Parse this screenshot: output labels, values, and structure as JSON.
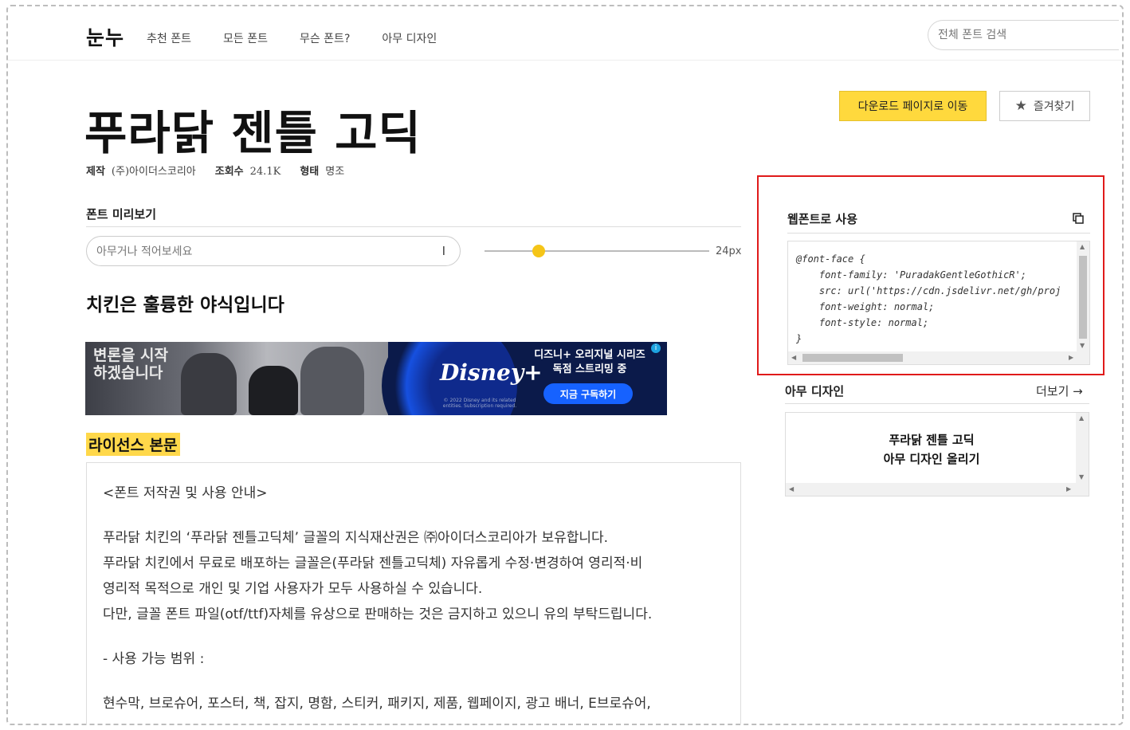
{
  "nav": {
    "logo": "눈누",
    "links": [
      "추천 폰트",
      "모든 폰트",
      "무슨 폰트?",
      "아무 디자인"
    ],
    "search_placeholder": "전체 폰트 검색"
  },
  "font": {
    "title": "푸라닭 젠틀 고딕",
    "maker_label": "제작",
    "maker": "(주)아이더스코리아",
    "views_label": "조회수",
    "views": "24.1K",
    "style_label": "형태",
    "style": "명조"
  },
  "actions": {
    "download": "다운로드 페이지로 이동",
    "favorite": "즐겨찾기"
  },
  "preview": {
    "heading": "폰트 미리보기",
    "input_placeholder": "아무거나 적어보세요",
    "size": "24px",
    "size_fraction": 0.24,
    "sample": "치킨은 훌륭한 야식입니다"
  },
  "ad": {
    "left_text": "변론을 시작하겠습니다",
    "brand": "Disney+",
    "fine_print": "© 2022 Disney and its related entities. Subscription required.",
    "headline": "디즈니+ 오리지널 시리즈 독점 스트리밍 중",
    "cta": "지금 구독하기",
    "info": "i"
  },
  "license": {
    "heading": "라이선스 본문",
    "title": "<폰트 저작권 및 사용 안내>",
    "p1": "푸라닭 치킨의 ‘푸라닭 젠틀고딕체’ 글꼴의 지식재산권은 ㈜아이더스코리아가 보유합니다.",
    "p2": "푸라닭 치킨에서 무료로 배포하는 글꼴은(푸라닭 젠틀고딕체) 자유롭게 수정·변경하여 영리적·비",
    "p3": "영리적 목적으로 개인 및 기업 사용자가 모두 사용하실 수 있습니다.",
    "p4": "다만, 글꼴 폰트 파일(otf/ttf)자체를 유상으로 판매하는 것은 금지하고 있으니 유의 부탁드립니다.",
    "range_title": "- 사용 가능 범위 :",
    "range_list": "현수막, 브로슈어, 포스터, 책, 잡지, 명함, 스티커, 패키지, 제품, 웹페이지, 광고 배너, E브로슈어,"
  },
  "webfont": {
    "heading": "웹폰트로 사용",
    "code": "@font-face {\n    font-family: 'PuradakGentleGothicR';\n    src: url('https://cdn.jsdelivr.net/gh/proj\n    font-weight: normal;\n    font-style: normal;\n}"
  },
  "anydesign": {
    "heading": "아무 디자인",
    "more": "더보기 →",
    "line1": "푸라닭 젠틀 고딕",
    "line2": "아무 디자인 올리기"
  },
  "colors": {
    "accent_yellow": "#ffd93d",
    "highlight_red": "#e01a1a",
    "slider_thumb": "#f5c518"
  }
}
